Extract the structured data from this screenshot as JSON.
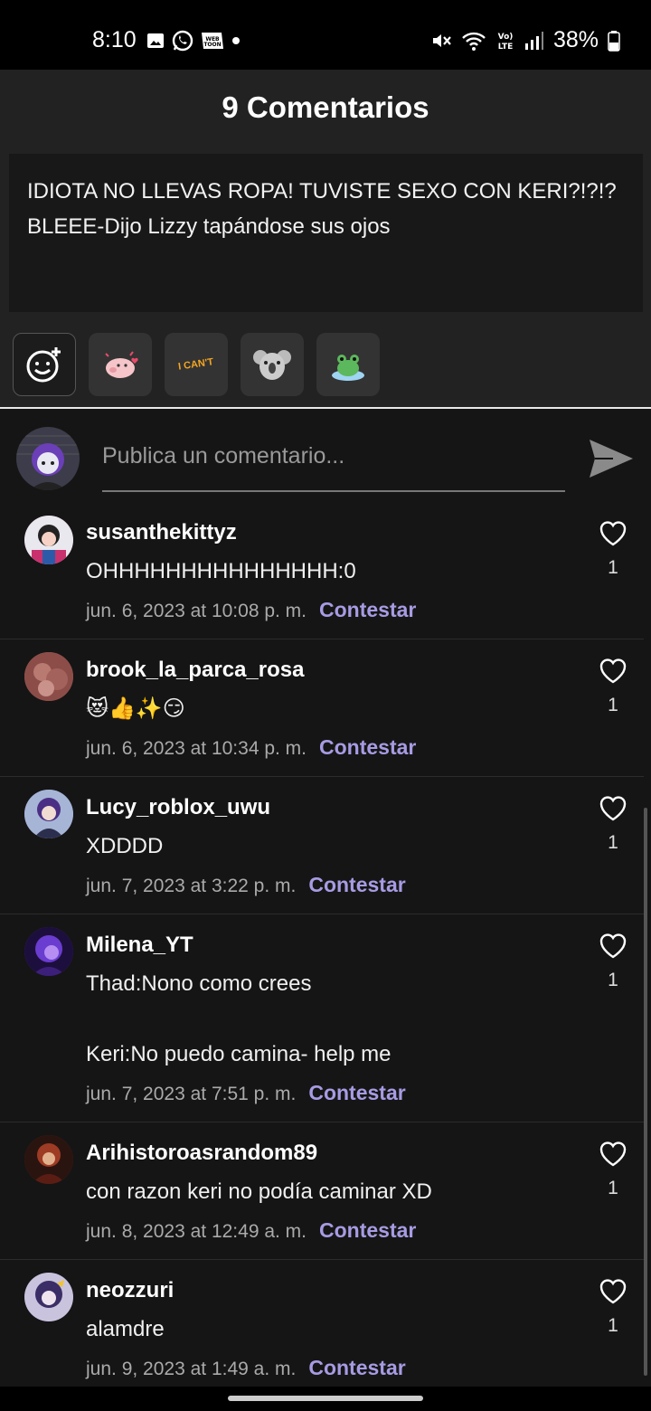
{
  "status": {
    "time": "8:10",
    "battery": "38%",
    "network": "Vo) LTE"
  },
  "header": {
    "title": "9 Comentarios"
  },
  "quote": {
    "text": "IDIOTA NO LLEVAS ROPA! TUVISTE SEXO CON KERI?!?!? BLEEE-Dijo Lizzy tapándose sus ojos"
  },
  "stickers": {
    "cant_label": "I CAN'T"
  },
  "compose": {
    "placeholder": "Publica un comentario..."
  },
  "comments": [
    {
      "user": "susanthekittyz",
      "text": "OHHHHHHHHHHHHHHH:0",
      "date": "jun. 6, 2023 at 10:08 p. m.",
      "reply": "Contestar",
      "likes": "1",
      "avatar_color": "#c8316d"
    },
    {
      "user": "brook_la_parca_rosa",
      "text": "😻👍✨😏",
      "date": "jun. 6, 2023 at 10:34 p. m.",
      "reply": "Contestar",
      "likes": "1",
      "avatar_color": "#9b5a55"
    },
    {
      "user": "Lucy_roblox_uwu",
      "text": "XDDDD",
      "date": "jun. 7, 2023 at 3:22 p. m.",
      "reply": "Contestar",
      "likes": "1",
      "avatar_color": "#5b6aa0"
    },
    {
      "user": "Milena_YT",
      "text": "Thad:Nono como crees\n\nKeri:No puedo camina- help me",
      "date": "jun. 7, 2023 at 7:51 p. m.",
      "reply": "Contestar",
      "likes": "1",
      "avatar_color": "#5a2da0"
    },
    {
      "user": "Arihistoroasrandom89",
      "text": "con razon keri no podía caminar XD",
      "date": "jun. 8, 2023 at 12:49 a. m.",
      "reply": "Contestar",
      "likes": "1",
      "avatar_color": "#6e2a1f"
    },
    {
      "user": "neozzuri",
      "text": "alamdre",
      "date": "jun. 9, 2023 at 1:49 a. m.",
      "reply": "Contestar",
      "likes": "1",
      "avatar_color": "#3b2e66"
    }
  ]
}
